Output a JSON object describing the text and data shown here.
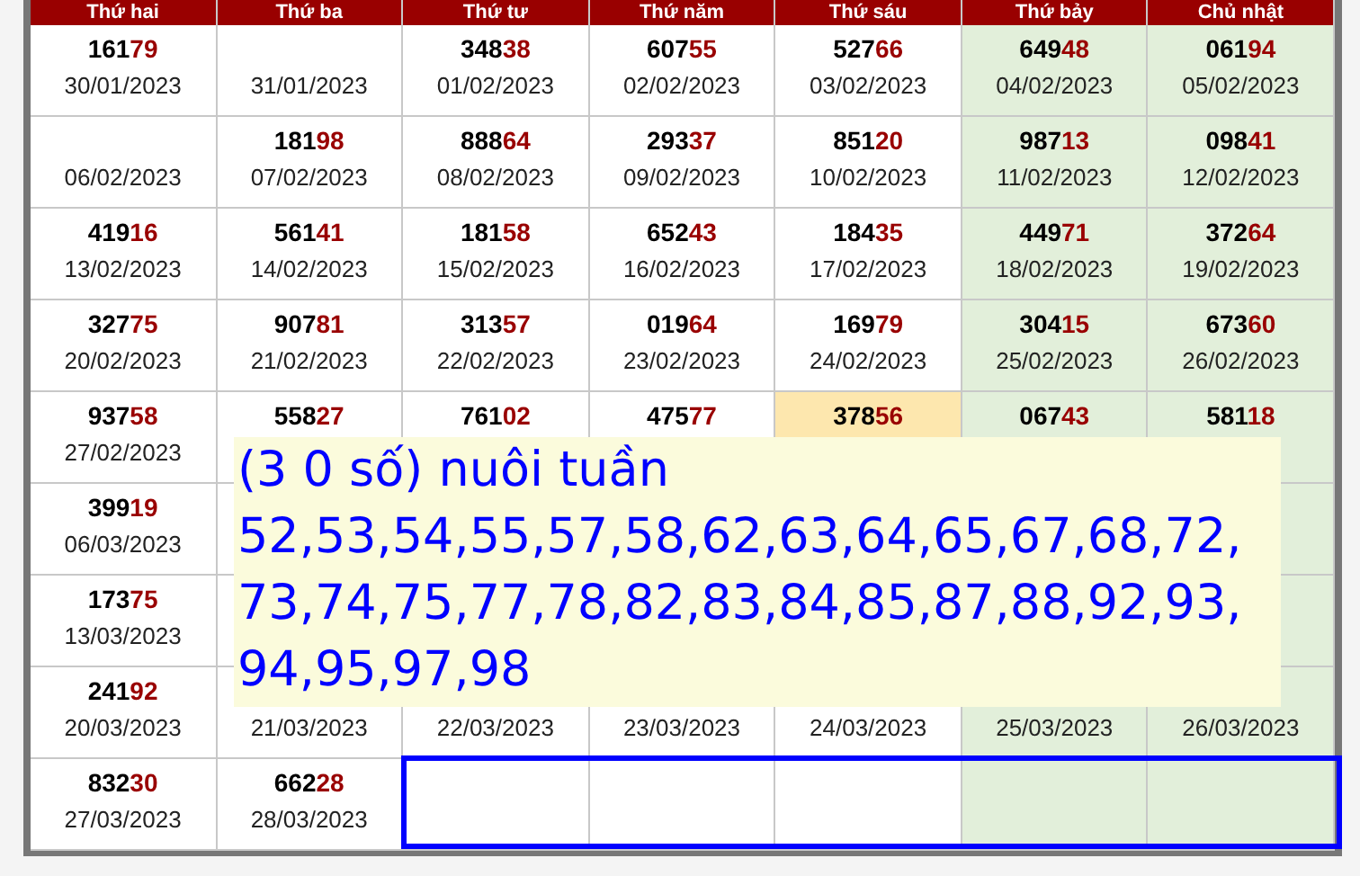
{
  "header": [
    "Thứ hai",
    "Thứ ba",
    "Thứ tư",
    "Thứ năm",
    "Thứ sáu",
    "Thứ bảy",
    "Chủ nhật"
  ],
  "rows": [
    [
      {
        "number": "16179",
        "date": "30/01/2023",
        "highlighted": false
      },
      {
        "date": "31/01/2023",
        "highlighted": false
      },
      {
        "number": "34838",
        "date": "01/02/2023",
        "highlighted": false
      },
      {
        "number": "60755",
        "date": "02/02/2023",
        "highlighted": false
      },
      {
        "number": "52766",
        "date": "03/02/2023",
        "highlighted": false
      },
      {
        "number": "64948",
        "date": "04/02/2023",
        "highlighted": false
      },
      {
        "number": "06194",
        "date": "05/02/2023",
        "highlighted": false
      }
    ],
    [
      {
        "date": "06/02/2023",
        "highlighted": false
      },
      {
        "number": "18198",
        "date": "07/02/2023",
        "highlighted": false
      },
      {
        "number": "88864",
        "date": "08/02/2023",
        "highlighted": false
      },
      {
        "number": "29337",
        "date": "09/02/2023",
        "highlighted": false
      },
      {
        "number": "85120",
        "date": "10/02/2023",
        "highlighted": false
      },
      {
        "number": "98713",
        "date": "11/02/2023",
        "highlighted": false
      },
      {
        "number": "09841",
        "date": "12/02/2023",
        "highlighted": false
      }
    ],
    [
      {
        "number": "41916",
        "date": "13/02/2023",
        "highlighted": false
      },
      {
        "number": "56141",
        "date": "14/02/2023",
        "highlighted": false
      },
      {
        "number": "18158",
        "date": "15/02/2023",
        "highlighted": false
      },
      {
        "number": "65243",
        "date": "16/02/2023",
        "highlighted": false
      },
      {
        "number": "18435",
        "date": "17/02/2023",
        "highlighted": false
      },
      {
        "number": "44971",
        "date": "18/02/2023",
        "highlighted": false
      },
      {
        "number": "37264",
        "date": "19/02/2023",
        "highlighted": false
      }
    ],
    [
      {
        "number": "32775",
        "date": "20/02/2023",
        "highlighted": false
      },
      {
        "number": "90781",
        "date": "21/02/2023",
        "highlighted": false
      },
      {
        "number": "31357",
        "date": "22/02/2023",
        "highlighted": false
      },
      {
        "number": "01964",
        "date": "23/02/2023",
        "highlighted": false
      },
      {
        "number": "16979",
        "date": "24/02/2023",
        "highlighted": false
      },
      {
        "number": "30415",
        "date": "25/02/2023",
        "highlighted": false
      },
      {
        "number": "67360",
        "date": "26/02/2023",
        "highlighted": false
      }
    ],
    [
      {
        "number": "93758",
        "date": "27/02/2023",
        "highlighted": false
      },
      {
        "number": "55827",
        "highlighted": false
      },
      {
        "number": "76102",
        "highlighted": false
      },
      {
        "number": "47577",
        "highlighted": false
      },
      {
        "number": "37856",
        "highlighted": true
      },
      {
        "number": "06743",
        "highlighted": false
      },
      {
        "number": "58118",
        "highlighted": false
      }
    ],
    [
      {
        "number": "39919",
        "date": "06/03/2023",
        "highlighted": false
      },
      {},
      {},
      {},
      {},
      {},
      {}
    ],
    [
      {
        "number": "17375",
        "date": "13/03/2023",
        "highlighted": false
      },
      {},
      {},
      {},
      {},
      {},
      {}
    ],
    [
      {
        "number": "24192",
        "date": "20/03/2023",
        "highlighted": false
      },
      {
        "date": "21/03/2023",
        "highlighted": false
      },
      {
        "date": "22/03/2023",
        "highlighted": false
      },
      {
        "date": "23/03/2023",
        "highlighted": false
      },
      {
        "date": "24/03/2023",
        "highlighted": false
      },
      {
        "date": "25/03/2023",
        "highlighted": false
      },
      {
        "date": "26/03/2023",
        "highlighted": false
      }
    ],
    [
      {
        "number": "83230",
        "date": "27/03/2023",
        "highlighted": false
      },
      {
        "number": "66228",
        "date": "28/03/2023",
        "highlighted": false
      },
      {
        "highlighted": false
      },
      {
        "highlighted": false
      },
      {
        "highlighted": false
      },
      {
        "highlighted": false
      },
      {
        "highlighted": false
      }
    ]
  ],
  "overlay": {
    "lines": [
      "(3 0 số) nuôi tuần",
      "52,53,54,55,57,58,62,63,64,65,67,68,72,",
      "73,74,75,77,78,82,83,84,85,87,88,92,93,",
      "94,95,97,98"
    ]
  }
}
